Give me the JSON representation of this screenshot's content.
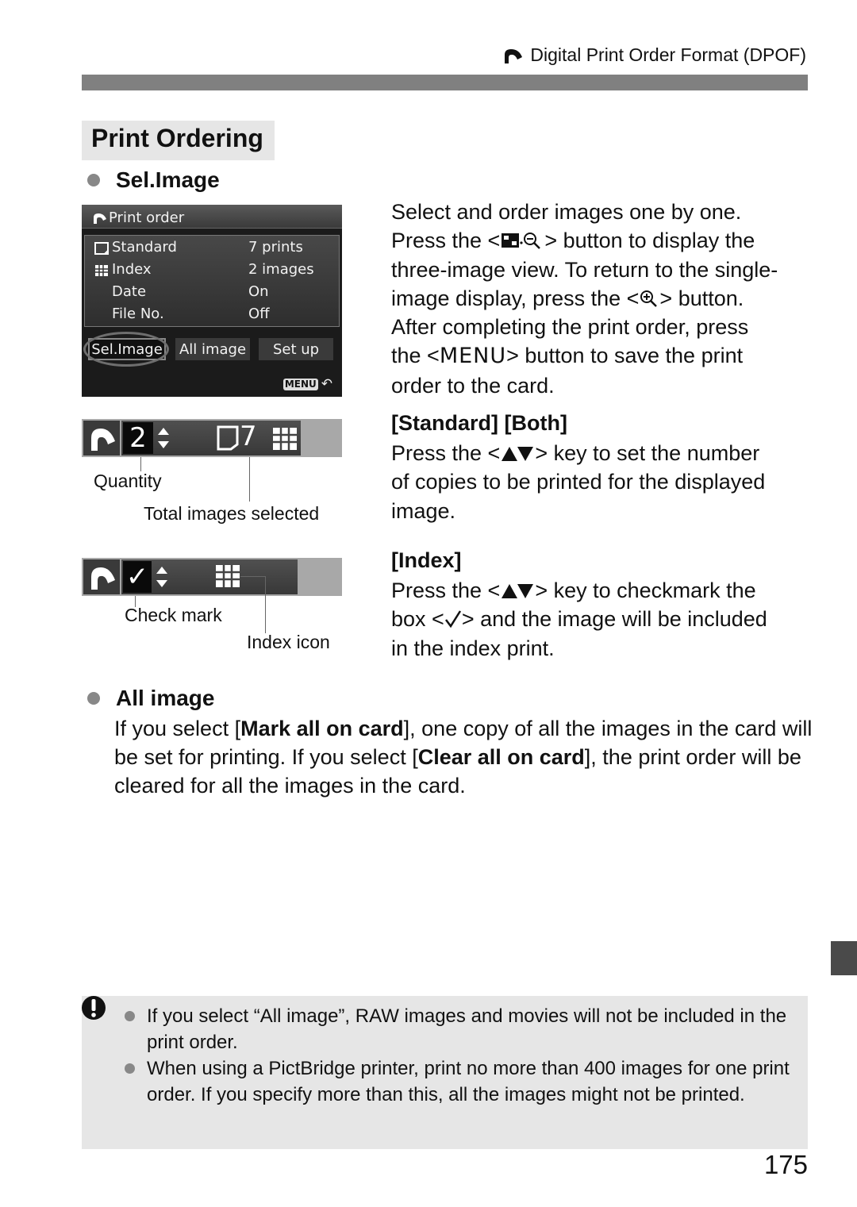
{
  "header": {
    "running_title": "Digital Print Order Format (DPOF)",
    "section_title": "Print Ordering"
  },
  "sel_image": {
    "heading": "Sel.Image",
    "lcd": {
      "title": "Print order",
      "rows": [
        {
          "label": "Standard",
          "value": "7 prints",
          "icon": "standard-print-icon"
        },
        {
          "label": "Index",
          "value": "2 images",
          "icon": "index-print-icon"
        },
        {
          "label": "Date",
          "value": "On"
        },
        {
          "label": "File No.",
          "value": "Off"
        }
      ],
      "buttons": [
        "Sel.Image",
        "All image",
        "Set up"
      ],
      "selected_button": "Sel.Image",
      "menu_label": "MENU"
    },
    "standard_strip": {
      "quantity": "2",
      "total_images": "7",
      "callouts": [
        "Quantity",
        "Total images selected"
      ]
    },
    "index_strip": {
      "check": "✓",
      "callouts": [
        "Check mark",
        "Index icon"
      ]
    },
    "description_lines": [
      "Select and order images one by one.",
      [
        "Press the <",
        "> button to display the"
      ],
      "three-image view. To return to the single-",
      [
        "image display, press the <",
        "> button."
      ],
      "After completing the print order, press",
      [
        "the <",
        "MENU",
        "> button to save the print"
      ],
      "order to the card."
    ],
    "standard_both": {
      "heading": "[Standard] [Both]",
      "lines": [
        [
          "Press the <",
          "> key to set the number"
        ],
        "of copies to be printed for the displayed",
        "image."
      ]
    },
    "index": {
      "heading": "[Index]",
      "lines": [
        [
          "Press the <",
          "> key to checkmark the"
        ],
        [
          "box <",
          "> and the image will be included"
        ],
        "in the index print."
      ]
    }
  },
  "all_image": {
    "heading": "All image",
    "text_parts": [
      "If you select [",
      "Mark all on card",
      "], one copy of all the images in the card will be set for printing. If you select [",
      "Clear all on card",
      "], the print order will be cleared for all the images in the card."
    ]
  },
  "caution": {
    "items": [
      "If you select “All image”, RAW images and movies will not be included in the print order.",
      "When using a PictBridge printer, print no more than 400 images for one print order. If you specify more than this, all the images might not be printed."
    ]
  },
  "page_number": "175"
}
